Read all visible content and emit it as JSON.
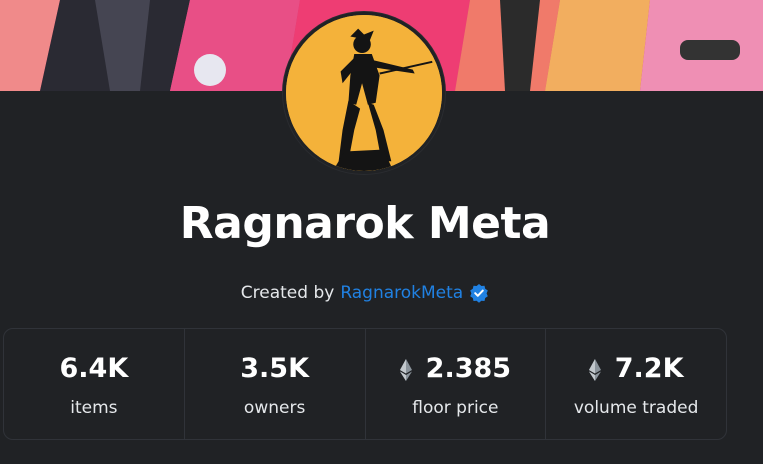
{
  "collection": {
    "title": "Ragnarok Meta",
    "created_by_label": "Created by",
    "creator_name": "RagnarokMeta",
    "verified_icon": "verified-badge-icon"
  },
  "stats": [
    {
      "value": "6.4K",
      "label": "items",
      "icon": ""
    },
    {
      "value": "3.5K",
      "label": "owners",
      "icon": ""
    },
    {
      "value": "2.385",
      "label": "floor price",
      "icon": "ethereum-icon"
    },
    {
      "value": "7.2K",
      "label": "volume traded",
      "icon": "ethereum-icon"
    }
  ],
  "colors": {
    "background": "#202225",
    "avatar_bg": "#f4b23a",
    "link": "#2081e2",
    "border": "#303339"
  }
}
